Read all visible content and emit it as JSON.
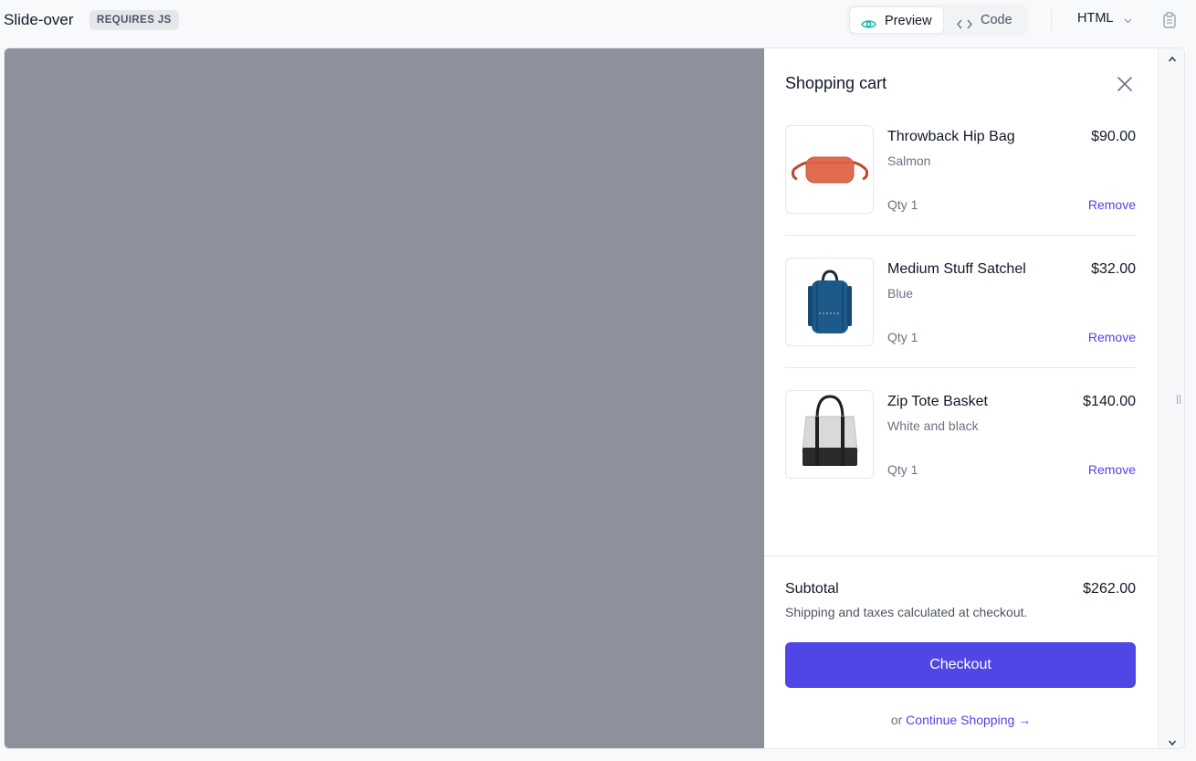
{
  "header": {
    "title": "Slide-over",
    "badge": "REQUIRES JS",
    "tabs": [
      {
        "label": "Preview",
        "icon": "eye-icon",
        "active": true
      },
      {
        "label": "Code",
        "icon": "code-brackets-icon",
        "active": false
      }
    ],
    "language": "HTML",
    "copy_icon": "clipboard-icon"
  },
  "cart": {
    "title": "Shopping cart",
    "close_icon": "close-icon",
    "items": [
      {
        "name": "Throwback Hip Bag",
        "variant": "Salmon",
        "price": "$90.00",
        "qty": "Qty 1",
        "remove": "Remove",
        "image_color": "#e06b4f"
      },
      {
        "name": "Medium Stuff Satchel",
        "variant": "Blue",
        "price": "$32.00",
        "qty": "Qty 1",
        "remove": "Remove",
        "image_color": "#1d5a8a"
      },
      {
        "name": "Zip Tote Basket",
        "variant": "White and black",
        "price": "$140.00",
        "qty": "Qty 1",
        "remove": "Remove",
        "image_color": "#2b2b2b"
      }
    ],
    "subtotal_label": "Subtotal",
    "subtotal_value": "$262.00",
    "shipping_note": "Shipping and taxes calculated at checkout.",
    "checkout_label": "Checkout",
    "continue_prefix": "or",
    "continue_label": "Continue Shopping →"
  },
  "colors": {
    "accent": "#4f46e5",
    "overlay": "#8d919c",
    "preview_icon": "#14b8a6"
  }
}
